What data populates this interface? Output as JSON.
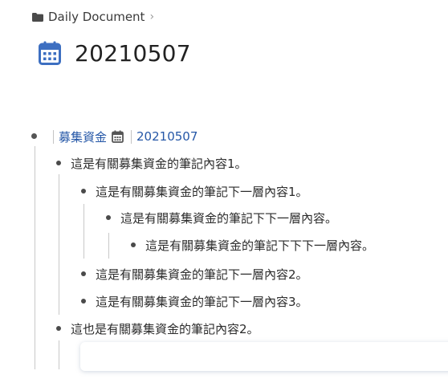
{
  "breadcrumb": {
    "folder_icon": "folder-icon",
    "label": "Daily Document",
    "separator": "›"
  },
  "page": {
    "icon": "calendar-icon",
    "title": "20210507"
  },
  "outline": {
    "root": {
      "tag": "募集資金",
      "tag_icon": "calendar-icon",
      "date": "20210507"
    },
    "items": [
      "這是有關募集資金的筆記內容1。",
      "這是有關募集資金的筆記下一層內容1。",
      "這是有關募集資金的筆記下下一層內容。",
      "這是有關募集資金的筆記下下下一層內容。",
      "這是有關募集資金的筆記下一層內容2。",
      "這是有關募集資金的筆記下一層內容3。",
      "這也是有關募集資金的筆記內容2。"
    ]
  },
  "colors": {
    "link": "#2557a7",
    "calendar_icon": "#3d6fc1",
    "guide": "#c8c8c8"
  }
}
